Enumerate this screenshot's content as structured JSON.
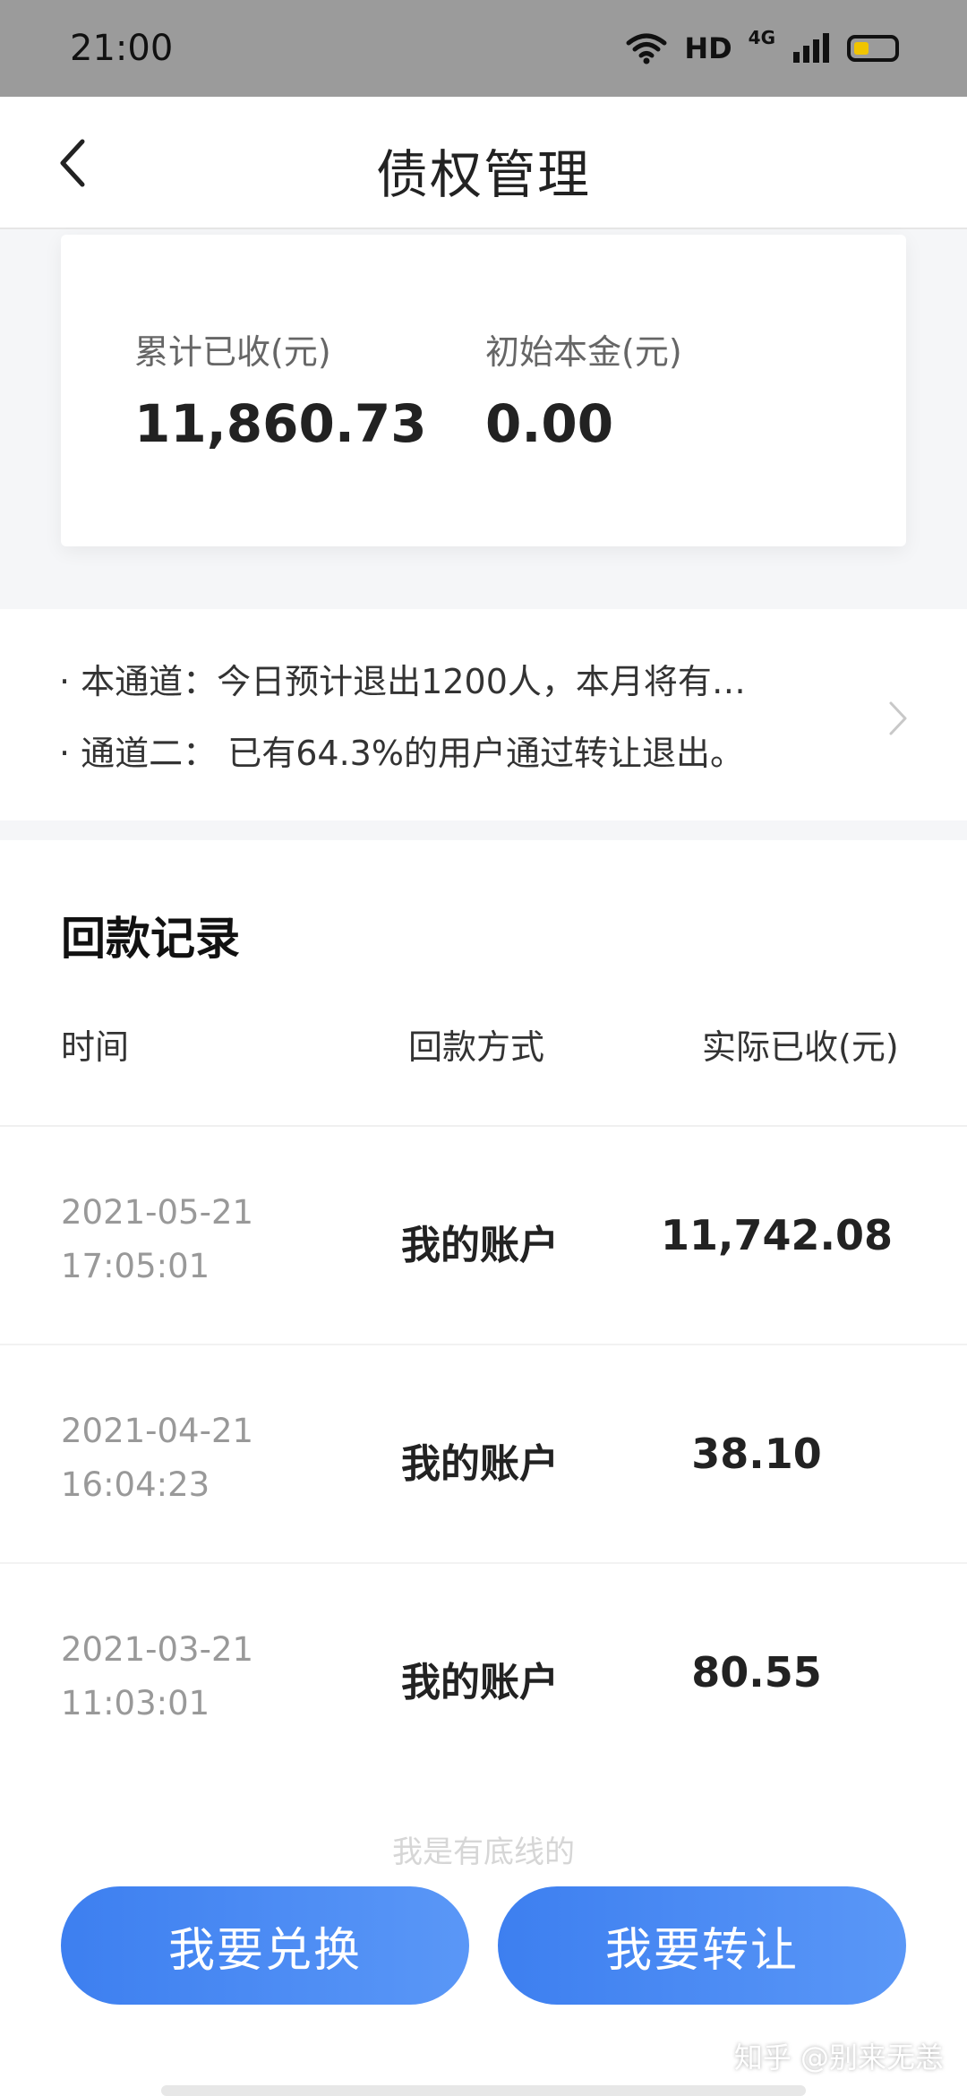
{
  "status_bar": {
    "time": "21:00",
    "hd": "HD",
    "network": "4G"
  },
  "nav": {
    "title": "债权管理"
  },
  "summary": {
    "total_received_label": "累计已收(元)",
    "total_received_value": "11,860.73",
    "principal_label": "初始本金(元)",
    "principal_value": "0.00"
  },
  "notices": [
    "· 本通道：今日预计退出1200人，本月将有…",
    "· 通道二： 已有64.3%的用户通过转让退出。"
  ],
  "records": {
    "title": "回款记录",
    "columns": [
      "时间",
      "回款方式",
      "实际已收(元)"
    ],
    "rows": [
      {
        "date": "2021-05-21",
        "time": "17:05:01",
        "method": "我的账户",
        "amount": "11,742.08"
      },
      {
        "date": "2021-04-21",
        "time": "16:04:23",
        "method": "我的账户",
        "amount": "38.10"
      },
      {
        "date": "2021-03-21",
        "time": "11:03:01",
        "method": "我的账户",
        "amount": "80.55"
      }
    ],
    "footer_note": "我是有底线的"
  },
  "actions": {
    "exchange_label": "我要兑换",
    "transfer_label": "我要转让"
  },
  "watermark": "知乎 @别来无恙",
  "colors": {
    "primary": "#3d7ff0",
    "status_bar": "#9b9b9b",
    "battery": "#f0c400"
  }
}
